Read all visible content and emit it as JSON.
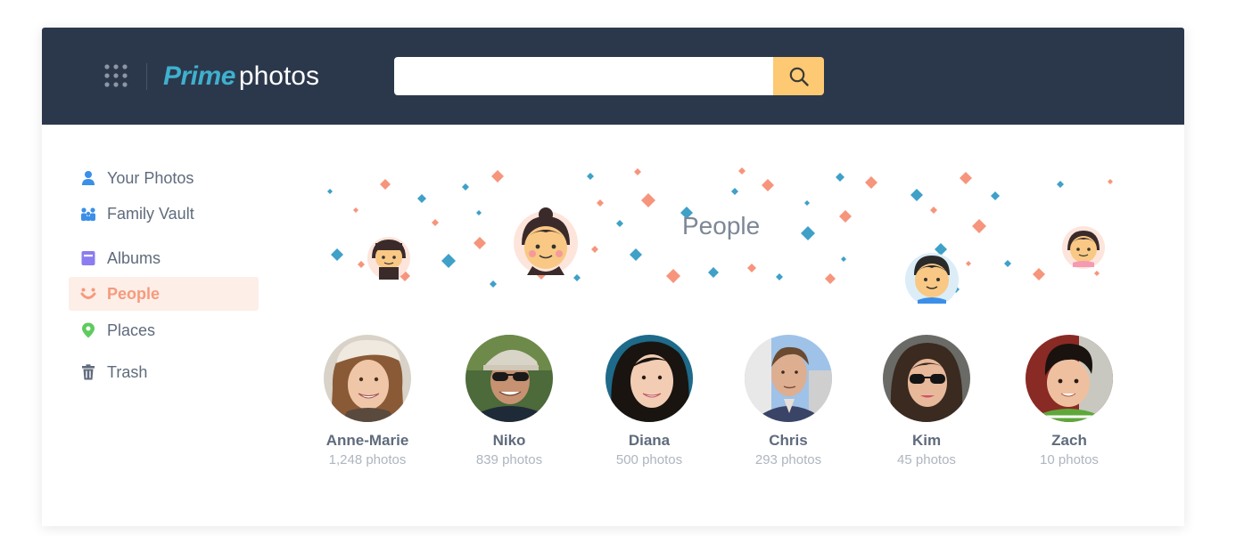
{
  "app": {
    "logo_prime": "Prime",
    "logo_photos": "photos"
  },
  "search": {
    "placeholder": "",
    "value": ""
  },
  "colors": {
    "topbar": "#2b384c",
    "accent": "#3fb0ce",
    "search_button": "#fdc973",
    "active_nav_bg": "#fdeee8",
    "active_nav_text": "#f69a7c"
  },
  "sidebar": {
    "items": [
      {
        "label": "Your Photos",
        "icon": "person-icon",
        "color": "#3b8fe8",
        "active": false
      },
      {
        "label": "Family Vault",
        "icon": "family-icon",
        "color": "#3b8fe8",
        "active": false
      },
      {
        "label": "Albums",
        "icon": "album-icon",
        "color": "#8b7cf0",
        "active": false
      },
      {
        "label": "People",
        "icon": "smile-icon",
        "color": "#f69a7c",
        "active": true
      },
      {
        "label": "Places",
        "icon": "map-pin-icon",
        "color": "#5ecb5e",
        "active": false
      },
      {
        "label": "Trash",
        "icon": "trash-icon",
        "color": "#5f6b7c",
        "active": false
      }
    ]
  },
  "banner": {
    "title": "People"
  },
  "people": [
    {
      "name": "Anne-Marie",
      "count": "1,248 photos"
    },
    {
      "name": "Niko",
      "count": "839 photos"
    },
    {
      "name": "Diana",
      "count": "500 photos"
    },
    {
      "name": "Chris",
      "count": "293 photos"
    },
    {
      "name": "Kim",
      "count": "45 photos"
    },
    {
      "name": "Zach",
      "count": "10 photos"
    }
  ]
}
